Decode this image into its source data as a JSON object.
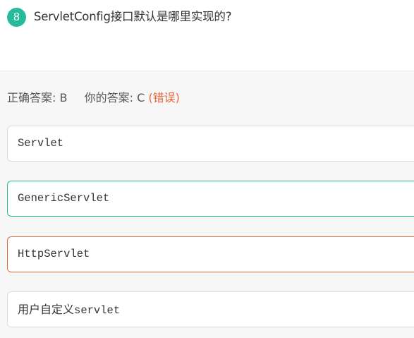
{
  "question": {
    "number": "8",
    "text": "ServletConfig接口默认是哪里实现的?"
  },
  "result": {
    "correct_label": "正确答案:",
    "correct_value": "B",
    "yours_label": "你的答案:",
    "yours_value": "C",
    "status": "(错误)"
  },
  "options": [
    {
      "text": "Servlet",
      "state": "normal"
    },
    {
      "text": "GenericServlet",
      "state": "correct"
    },
    {
      "text": "HttpServlet",
      "state": "wrong"
    },
    {
      "prefix": "用户自定义",
      "text": "servlet",
      "state": "normal"
    }
  ],
  "colors": {
    "accent": "#25bb9b",
    "error": "#e8673d"
  }
}
